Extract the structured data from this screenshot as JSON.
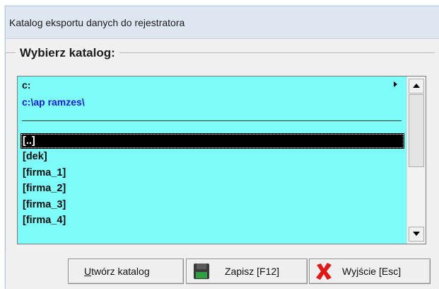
{
  "window": {
    "title": "Katalog eksportu danych do rejestratora"
  },
  "group": {
    "legend": "Wybierz katalog:"
  },
  "drive": {
    "value": "c:"
  },
  "path": {
    "value": "c:\\ap ramzes\\"
  },
  "directories": [
    "[..]",
    "[dek]",
    "[firma_1]",
    "[firma_2]",
    "[firma_3]",
    "[firma_4]"
  ],
  "selected_index": 0,
  "buttons": {
    "create": {
      "mnemonic": "U",
      "rest": "twórz katalog"
    },
    "save": {
      "label": "Zapisz  [F12]",
      "icon": "floppy-disk-icon"
    },
    "exit": {
      "label": "Wyjście  [Esc]",
      "icon": "red-x-icon"
    }
  },
  "colors": {
    "list_background": "#7dfcfa",
    "path_text": "#1a20c8",
    "selection": "#000000"
  }
}
